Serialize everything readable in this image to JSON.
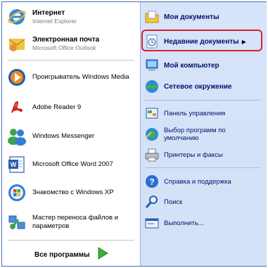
{
  "left_items": [
    {
      "title": "Интернет",
      "subtitle": "Internet Explorer",
      "icon": "internet-explorer-icon"
    },
    {
      "title": "Электронная почта",
      "subtitle": "Microsoft Office Outlook",
      "icon": "outlook-icon"
    },
    {
      "label": "Проигрыватель Windows Media",
      "icon": "windows-media-player-icon"
    },
    {
      "label": "Adobe Reader 9",
      "icon": "adobe-reader-icon"
    },
    {
      "label": "Windows Messenger",
      "icon": "windows-messenger-icon"
    },
    {
      "label": "Microsoft Office Word 2007",
      "icon": "word-icon"
    },
    {
      "label": "Знакомство с Windows XP",
      "icon": "windows-tour-icon"
    },
    {
      "label": "Мастер переноса файлов и параметров",
      "icon": "transfer-wizard-icon"
    }
  ],
  "all_programs": "Все программы",
  "right_items": [
    {
      "label": "Мои документы",
      "bold": true
    },
    {
      "label": "Недавние документы",
      "bold": true,
      "submenu": true,
      "highlighted": true
    },
    {
      "label": "Мой компьютер",
      "bold": true
    },
    {
      "label": "Сетевое окружение",
      "bold": true
    },
    {
      "label": "Панель управления"
    },
    {
      "label": "Выбор программ по умолчанию"
    },
    {
      "label": "Принтеры и факсы"
    },
    {
      "label": "Справка и поддержка"
    },
    {
      "label": "Поиск"
    },
    {
      "label": "Выполнить..."
    }
  ],
  "colors": {
    "highlight_border": "#d3232a",
    "right_panel": "#d6e3f8",
    "right_text": "#00136b"
  }
}
